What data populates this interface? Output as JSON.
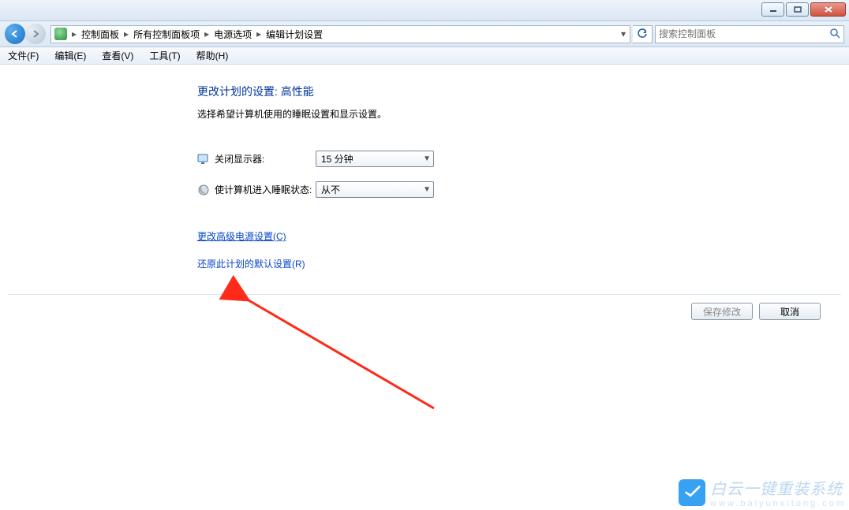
{
  "titlebar": {},
  "breadcrumbs": {
    "items": [
      "控制面板",
      "所有控制面板项",
      "电源选项",
      "编辑计划设置"
    ]
  },
  "search": {
    "placeholder": "搜索控制面板"
  },
  "menu": {
    "file": "文件(F)",
    "edit": "编辑(E)",
    "view": "查看(V)",
    "tools": "工具(T)",
    "help": "帮助(H)"
  },
  "page": {
    "title": "更改计划的设置: 高性能",
    "subtitle": "选择希望计算机使用的睡眠设置和显示设置。"
  },
  "settings": {
    "display_off_label": "关闭显示器:",
    "display_off_value": "15 分钟",
    "sleep_label": "使计算机进入睡眠状态:",
    "sleep_value": "从不"
  },
  "links": {
    "advanced": "更改高级电源设置(C)",
    "restore": "还原此计划的默认设置(R)"
  },
  "buttons": {
    "save": "保存修改",
    "cancel": "取消"
  },
  "watermark": {
    "brand": "白云一键重装系统",
    "url": "www.baiyunxitong.com"
  }
}
